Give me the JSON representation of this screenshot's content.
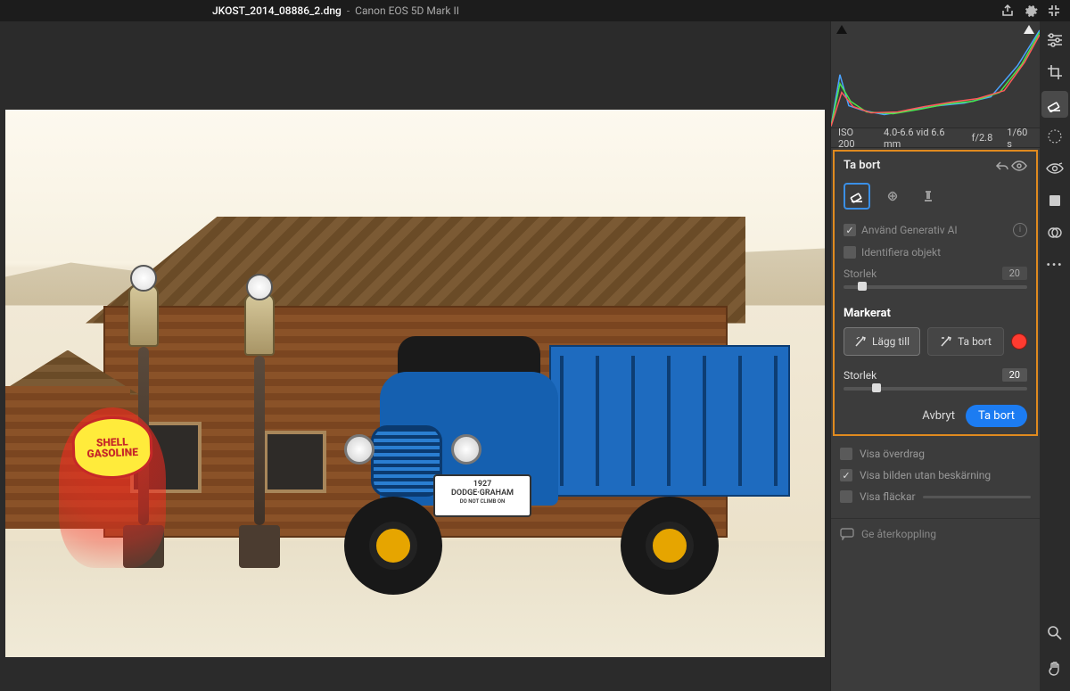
{
  "topbar": {
    "filename": "JKOST_2014_08886_2.dng",
    "separator": "-",
    "camera": "Canon EOS 5D Mark II"
  },
  "exif": {
    "iso": "ISO 200",
    "focal": "4.0-6.6 vid 6.6 mm",
    "aperture": "f/2.8",
    "shutter": "1/60 s"
  },
  "remove_panel": {
    "title": "Ta bort",
    "opt_gen_ai": "Använd Generativ AI",
    "opt_identify": "Identifiera objekt",
    "size_label": "Storlek",
    "size_value": "20"
  },
  "selected_panel": {
    "title": "Markerat",
    "add_label": "Lägg till",
    "remove_label": "Ta bort",
    "size_label": "Storlek",
    "size_value": "20",
    "cancel": "Avbryt",
    "apply": "Ta bort"
  },
  "view_options": {
    "overlay": "Visa överdrag",
    "uncropped": "Visa bilden utan beskärning",
    "spots": "Visa fläckar"
  },
  "feedback": {
    "label": "Ge återkoppling"
  },
  "photo": {
    "sign_line1": "SHELL",
    "sign_line2": "GASOLINE",
    "plate_year": "1927",
    "plate_make": "DODGE·GRAHAM",
    "plate_warn": "DO NOT CLIMB ON"
  }
}
